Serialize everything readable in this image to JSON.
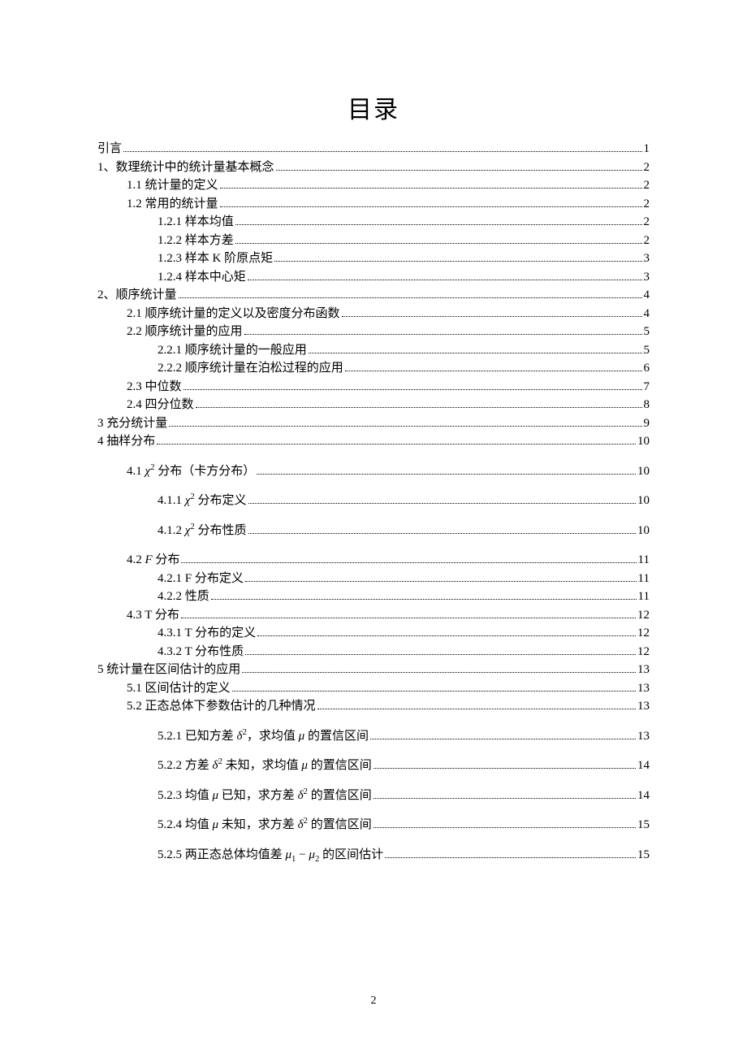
{
  "title": "目录",
  "footerPage": "2",
  "entries": [
    {
      "level": 0,
      "label": "引言",
      "page": "1",
      "gap": ""
    },
    {
      "level": 0,
      "label": "1、数理统计中的统计量基本概念",
      "page": "2",
      "gap": ""
    },
    {
      "level": 1,
      "label": "1.1   统计量的定义",
      "page": "2",
      "gap": ""
    },
    {
      "level": 1,
      "label": "1.2   常用的统计量",
      "page": "2",
      "gap": ""
    },
    {
      "level": 2,
      "label": "1.2.1 样本均值",
      "page": "2",
      "gap": ""
    },
    {
      "level": 2,
      "label": "1.2.2   样本方差",
      "page": "2",
      "gap": ""
    },
    {
      "level": 2,
      "label": "1.2.3   样本 K 阶原点矩",
      "page": "3",
      "gap": ""
    },
    {
      "level": 2,
      "label": "1.2.4 样本中心矩",
      "page": "3",
      "gap": ""
    },
    {
      "level": 0,
      "label": "2、顺序统计量",
      "page": "4",
      "gap": ""
    },
    {
      "level": 1,
      "label": "2.1 顺序统计量的定义以及密度分布函数",
      "page": "4",
      "gap": ""
    },
    {
      "level": 1,
      "label": "2.2 顺序统计量的应用",
      "page": "5",
      "gap": ""
    },
    {
      "level": 2,
      "label": "2.2.1 顺序统计量的一般应用",
      "page": "5",
      "gap": ""
    },
    {
      "level": 2,
      "label": "2.2.2 顺序统计量在泊松过程的应用",
      "page": "6",
      "gap": ""
    },
    {
      "level": 1,
      "label": "2.3 中位数",
      "page": "7",
      "gap": ""
    },
    {
      "level": 1,
      "label": "2.4 四分位数",
      "page": "8",
      "gap": ""
    },
    {
      "level": 0,
      "label": "3    充分统计量",
      "page": "9",
      "gap": ""
    },
    {
      "level": 0,
      "label": "4    抽样分布",
      "page": "10",
      "gap": ""
    },
    {
      "level": 1,
      "label": "4.1   <i>χ</i><sup>2</sup> 分布（卡方分布）",
      "page": "10",
      "gap": "math"
    },
    {
      "level": 2,
      "label": "4.1.1 <i>χ</i><sup>2</sup> 分布定义",
      "page": "10",
      "gap": "math"
    },
    {
      "level": 2,
      "label": "4.1.2  <i>χ</i><sup>2</sup> 分布性质 ",
      "page": "10",
      "gap": "math"
    },
    {
      "level": 1,
      "label": "4.2   <i>F</i> 分布 ",
      "page": "11",
      "gap": "mtop"
    },
    {
      "level": 2,
      "label": "4.2.1   F 分布定义 ",
      "page": "11",
      "gap": ""
    },
    {
      "level": 2,
      "label": "4.2.2  性质",
      "page": "11",
      "gap": ""
    },
    {
      "level": 1,
      "label": "4.3   T 分布 ",
      "page": "12",
      "gap": ""
    },
    {
      "level": 2,
      "label": "4.3.1   T 分布的定义 ",
      "page": "12",
      "gap": ""
    },
    {
      "level": 2,
      "label": "4.3.2   T 分布性质 ",
      "page": "12",
      "gap": ""
    },
    {
      "level": 0,
      "label": "5    统计量在区间估计的应用",
      "page": "13",
      "gap": ""
    },
    {
      "level": 1,
      "label": "5.1   区间估计的定义",
      "page": "13",
      "gap": ""
    },
    {
      "level": 1,
      "label": "5.2   正态总体下参数估计的几种情况",
      "page": "13",
      "gap": ""
    },
    {
      "level": 2,
      "label": "5.2.1 已知方差 <i>δ</i><sup>2</sup>，求均值 <i>μ</i> 的置信区间 ",
      "page": "13",
      "gap": "math"
    },
    {
      "level": 2,
      "label": "5.2.2  方差 <i>δ</i><sup>2</sup> 未知，求均值 <i>μ</i> 的置信区间 ",
      "page": "14",
      "gap": "math"
    },
    {
      "level": 2,
      "label": "5.2.3  均值 <i>μ</i> 已知，求方差 <i>δ</i><sup>2</sup> 的置信区间 ",
      "page": "14",
      "gap": "math"
    },
    {
      "level": 2,
      "label": "5.2.4  均值 <i>μ</i> 未知，求方差 <i>δ</i><sup>2</sup> 的置信区间 ",
      "page": "15",
      "gap": "math"
    },
    {
      "level": 2,
      "label": "5.2.5  两正态总体均值差 <i>μ</i><sub>1</sub> − <i>μ</i><sub>2</sub> 的区间估计 ",
      "page": "15",
      "gap": "math"
    }
  ]
}
